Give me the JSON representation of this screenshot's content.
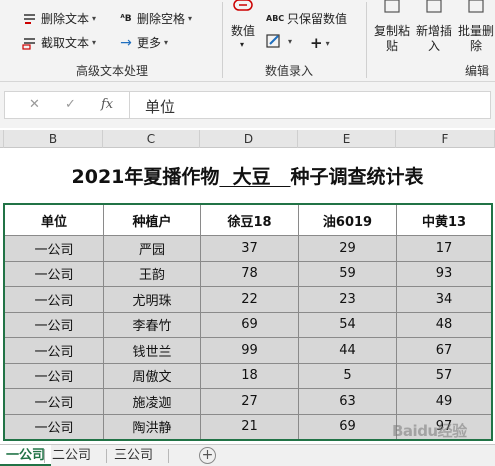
{
  "ribbon": {
    "advanced_text": {
      "group_label": "高级文本处理",
      "delete_text": "删除文本",
      "extract_text": "截取文本",
      "delete_space": "删除空格",
      "more": "更多"
    },
    "data_entry": {
      "group_label": "数值录入",
      "numeric": "数值",
      "keep_numeric": "只保留数值",
      "plus": "+"
    },
    "edit": {
      "group_label": "编辑",
      "copy_paste_line1": "复制粘",
      "copy_paste_line2": "贴",
      "insert_line1": "新增插",
      "insert_line2": "入",
      "batch_delete_line1": "批量删",
      "batch_delete_line2": "除"
    }
  },
  "formula_bar": {
    "cancel": "✕",
    "confirm": "✓",
    "fx": "fx",
    "value": "单位"
  },
  "columns": [
    "B",
    "C",
    "D",
    "E",
    "F"
  ],
  "table": {
    "title_prefix": "2021年夏播作物",
    "title_crop": "  大豆   ",
    "title_suffix": "种子调查统计表",
    "headers": [
      "单位",
      "种植户",
      "徐豆18",
      "油6019",
      "中黄13"
    ],
    "rows": [
      [
        "一公司",
        "严园",
        "37",
        "29",
        "17"
      ],
      [
        "一公司",
        "王韵",
        "78",
        "59",
        "93"
      ],
      [
        "一公司",
        "尤明珠",
        "22",
        "23",
        "34"
      ],
      [
        "一公司",
        "李春竹",
        "69",
        "54",
        "48"
      ],
      [
        "一公司",
        "钱世兰",
        "99",
        "44",
        "67"
      ],
      [
        "一公司",
        "周傲文",
        "18",
        "5",
        "57"
      ],
      [
        "一公司",
        "施凌迦",
        "27",
        "63",
        "49"
      ],
      [
        "一公司",
        "陶洪静",
        "21",
        "69",
        "97"
      ]
    ]
  },
  "sheets": {
    "tab1": "一公司",
    "tab2": "二公司",
    "tab3": "三公司",
    "add": "+"
  },
  "watermark": "Baidu经验",
  "colors": {
    "excel_green": "#217346",
    "cell_fill": "#d7d7d7"
  }
}
